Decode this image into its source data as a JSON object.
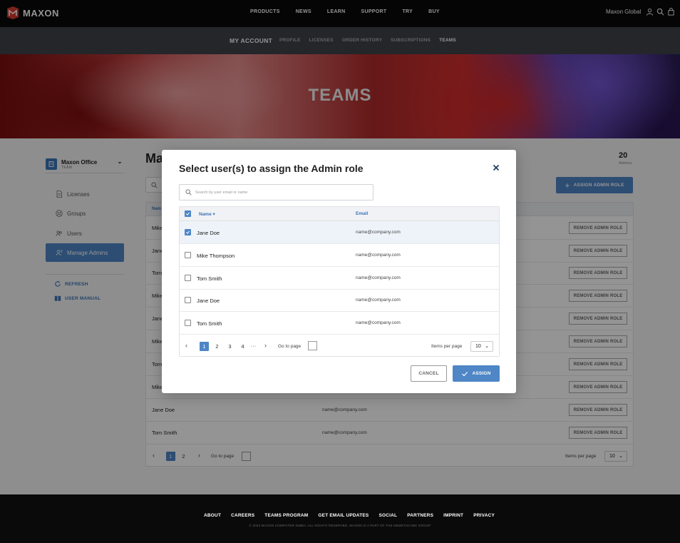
{
  "top_nav": {
    "logo": "MAXON",
    "links": [
      "PRODUCTS",
      "NEWS",
      "LEARN",
      "SUPPORT",
      "TRY",
      "BUY"
    ],
    "region": "Maxon Global",
    "icons": [
      "user-icon",
      "search-icon",
      "cart-icon"
    ]
  },
  "sub_nav": {
    "title": "MY ACCOUNT",
    "links": [
      "PROFILE",
      "LICENSES",
      "ORDER HISTORY",
      "SUBSCRIPTIONS",
      "TEAMS"
    ],
    "active": "TEAMS"
  },
  "hero": {
    "title": "TEAMS"
  },
  "sidebar": {
    "team_name": "Maxon Office",
    "team_label": "TEAM",
    "items": [
      {
        "label": "Licenses",
        "icon": "document-icon"
      },
      {
        "label": "Groups",
        "icon": "groups-icon"
      },
      {
        "label": "Users",
        "icon": "users-icon"
      },
      {
        "label": "Manage Admins",
        "icon": "admin-icon"
      }
    ],
    "active_item": "Manage Admins",
    "links": [
      {
        "label": "REFRESH",
        "icon": "refresh-icon"
      },
      {
        "label": "USER MANUAL",
        "icon": "book-icon"
      }
    ]
  },
  "main": {
    "title": "Ma",
    "admins_count": "20",
    "admins_label": "Admins",
    "assign_button": "ASSIGN ADMIN ROLE",
    "table": {
      "header_name": "Nam",
      "remove_label": "REMOVE ADMIN ROLE",
      "rows": [
        {
          "name": "Mike",
          "email": ""
        },
        {
          "name": "Jane",
          "email": ""
        },
        {
          "name": "Tom",
          "email": ""
        },
        {
          "name": "Mike",
          "email": ""
        },
        {
          "name": "Jane",
          "email": ""
        },
        {
          "name": "Mike",
          "email": ""
        },
        {
          "name": "Tom",
          "email": ""
        },
        {
          "name": "Mike",
          "email": ""
        },
        {
          "name": "Jane Doe",
          "email": "name@company.com"
        },
        {
          "name": "Tom Smith",
          "email": "name@company.com"
        }
      ]
    },
    "pagination": {
      "pages": [
        "1",
        "2"
      ],
      "active_page": "1",
      "goto_label": "Go to page",
      "items_per_page_label": "Items per page",
      "items_per_page": "10"
    }
  },
  "modal": {
    "title": "Select user(s) to assign the Admin role",
    "search_placeholder": "Search by user email or name",
    "col_name": "Name",
    "col_email": "Email",
    "rows": [
      {
        "name": "Jane Doe",
        "email": "name@company.com",
        "checked": true
      },
      {
        "name": "Mike Thompson",
        "email": "name@company.com",
        "checked": false
      },
      {
        "name": "Tom Smith",
        "email": "name@company.com",
        "checked": false
      },
      {
        "name": "Jane Doe",
        "email": "name@company.com",
        "checked": false
      },
      {
        "name": "Tom Smith",
        "email": "name@company.com",
        "checked": false
      }
    ],
    "pagination": {
      "pages": [
        "1",
        "2",
        "3",
        "4"
      ],
      "ellipsis": "···",
      "active_page": "1",
      "goto_label": "Go to page",
      "items_per_page_label": "Items per page",
      "items_per_page": "10"
    },
    "cancel_label": "CANCEL",
    "assign_label": "ASSIGN"
  },
  "footer": {
    "links": [
      "ABOUT",
      "CAREERS",
      "TEAMS PROGRAM",
      "GET EMAIL UPDATES",
      "SOCIAL",
      "PARTNERS",
      "IMPRINT",
      "PRIVACY"
    ],
    "copyright": "© 2023 MAXON COMPUTER GMBH. ALL RIGHTS RESERVED. MAXON IS A PART OF THE NEMETSCHEK GROUP"
  },
  "colors": {
    "accent": "#4e86c6",
    "link": "#3c75b9",
    "nav_bg": "#0a0a0a",
    "subnav_bg": "#3e4349"
  }
}
